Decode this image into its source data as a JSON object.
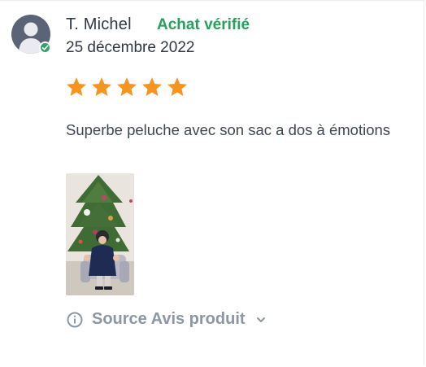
{
  "review": {
    "author": "T. Michel",
    "verified_label": "Achat vérifié",
    "date": "25 décembre 2022",
    "rating": 5,
    "max_rating": 5,
    "text": "Superbe peluche avec son sac a dos à émotions",
    "source_label": "Source Avis produit"
  },
  "icons": {
    "avatar": "user-silhouette-icon",
    "verified": "check-icon",
    "star": "star-icon",
    "info": "info-circle-icon",
    "chevron": "chevron-down-icon"
  },
  "colors": {
    "star": "#f7941d",
    "verified": "#27a05c",
    "text": "#2f3844",
    "muted": "#8c97a3",
    "avatar_bg": "#5b6476"
  }
}
